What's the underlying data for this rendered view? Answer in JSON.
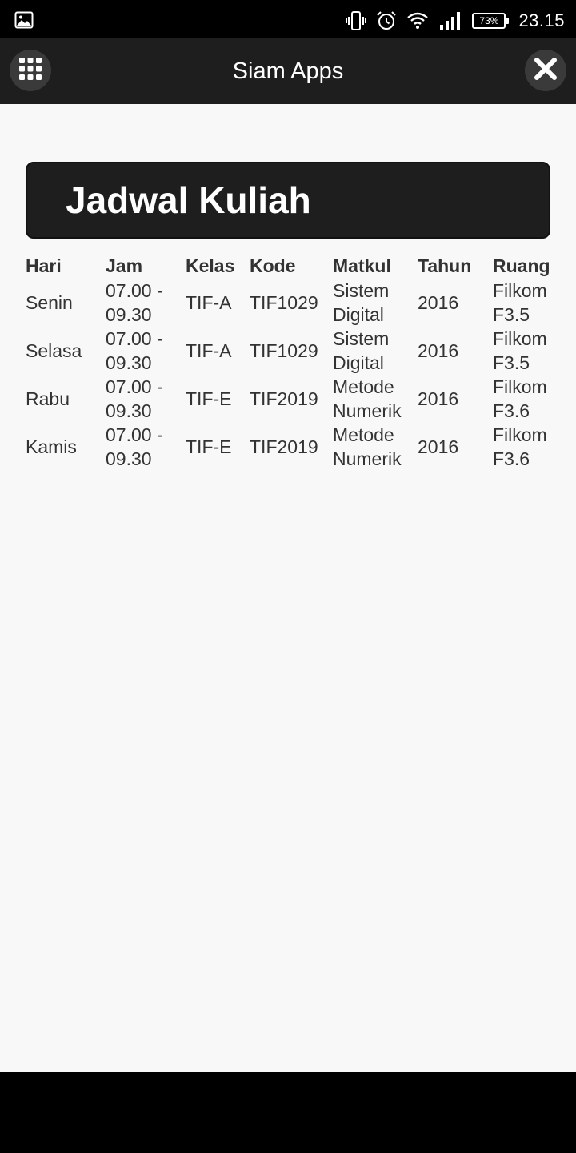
{
  "status_bar": {
    "battery_percent": "73%",
    "time": "23.15",
    "icons": [
      "image-icon",
      "vibrate-icon",
      "alarm-icon",
      "wifi-icon",
      "signal-icon",
      "battery-icon"
    ]
  },
  "app_bar": {
    "title": "Siam Apps",
    "menu_icon": "grid-menu-icon",
    "close_icon": "close-icon"
  },
  "banner": {
    "title": "Jadwal Kuliah"
  },
  "schedule": {
    "headers": {
      "hari": "Hari",
      "jam": "Jam",
      "kelas": "Kelas",
      "kode": "Kode",
      "matkul": "Matkul",
      "tahun": "Tahun",
      "ruang": "Ruang"
    },
    "rows": [
      {
        "hari": "Senin",
        "jam": "07.00 - 09.30",
        "kelas": "TIF-A",
        "kode": "TIF1029",
        "matkul": "Sistem Digital",
        "tahun": "2016",
        "ruang": "Filkom F3.5"
      },
      {
        "hari": "Selasa",
        "jam": "07.00 - 09.30",
        "kelas": "TIF-A",
        "kode": "TIF1029",
        "matkul": "Sistem Digital",
        "tahun": "2016",
        "ruang": "Filkom F3.5"
      },
      {
        "hari": "Rabu",
        "jam": "07.00 - 09.30",
        "kelas": "TIF-E",
        "kode": "TIF2019",
        "matkul": "Metode Numerik",
        "tahun": "2016",
        "ruang": "Filkom F3.6"
      },
      {
        "hari": "Kamis",
        "jam": "07.00 - 09.30",
        "kelas": "TIF-E",
        "kode": "TIF2019",
        "matkul": "Metode Numerik",
        "tahun": "2016",
        "ruang": "Filkom F3.6"
      }
    ]
  },
  "colors": {
    "app_bar": "#1e1e1e",
    "banner": "#1e1e1e",
    "content_bg": "#f8f8f8",
    "text": "#333333"
  }
}
